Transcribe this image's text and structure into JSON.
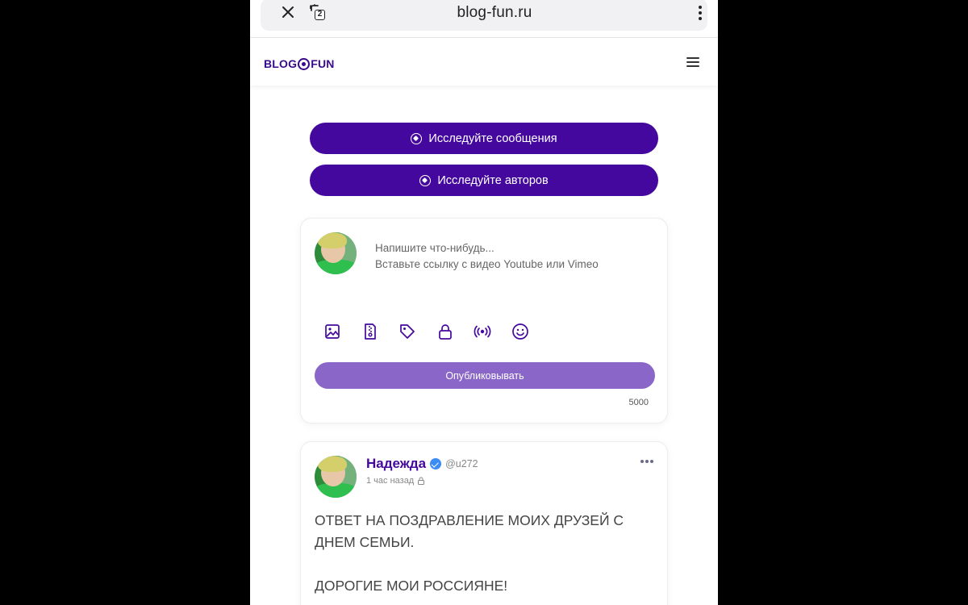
{
  "browser": {
    "url": "blog-fun.ru",
    "tab_count": "2",
    "close_icon": "close-icon",
    "tabs_icon": "tabs-icon",
    "menu_icon": "more-vert-icon"
  },
  "header": {
    "logo_left": "BLOG",
    "logo_right": "FUN",
    "menu_icon": "hamburger-icon"
  },
  "explore": {
    "posts_label": "Исследуйте сообщения",
    "authors_label": "Исследуйте авторов",
    "icon": "compass-icon"
  },
  "composer": {
    "placeholder_line1": "Напишите что-нибудь...",
    "placeholder_line2": "Вставьте ссылку с видео Youtube или Vimeo",
    "tools": [
      "image-icon",
      "file-zip-icon",
      "tag-icon",
      "lock-icon",
      "broadcast-icon",
      "smile-icon"
    ],
    "publish_label": "Опубликовывать",
    "char_limit": "5000"
  },
  "post": {
    "author_name": "Надежда",
    "handle": "@u272",
    "time": "1 час назад",
    "paragraphs": [
      "ОТВЕТ НА ПОЗДРАВЛЕНИЕ МОИХ ДРУЗЕЙ С ДНЕМ СЕМЬИ.",
      "ДОРОГИЕ МОИ РОССИЯНЕ!"
    ]
  },
  "colors": {
    "brand": "#45089e",
    "publish": "#8a66c8",
    "verified": "#3b8cf5"
  }
}
